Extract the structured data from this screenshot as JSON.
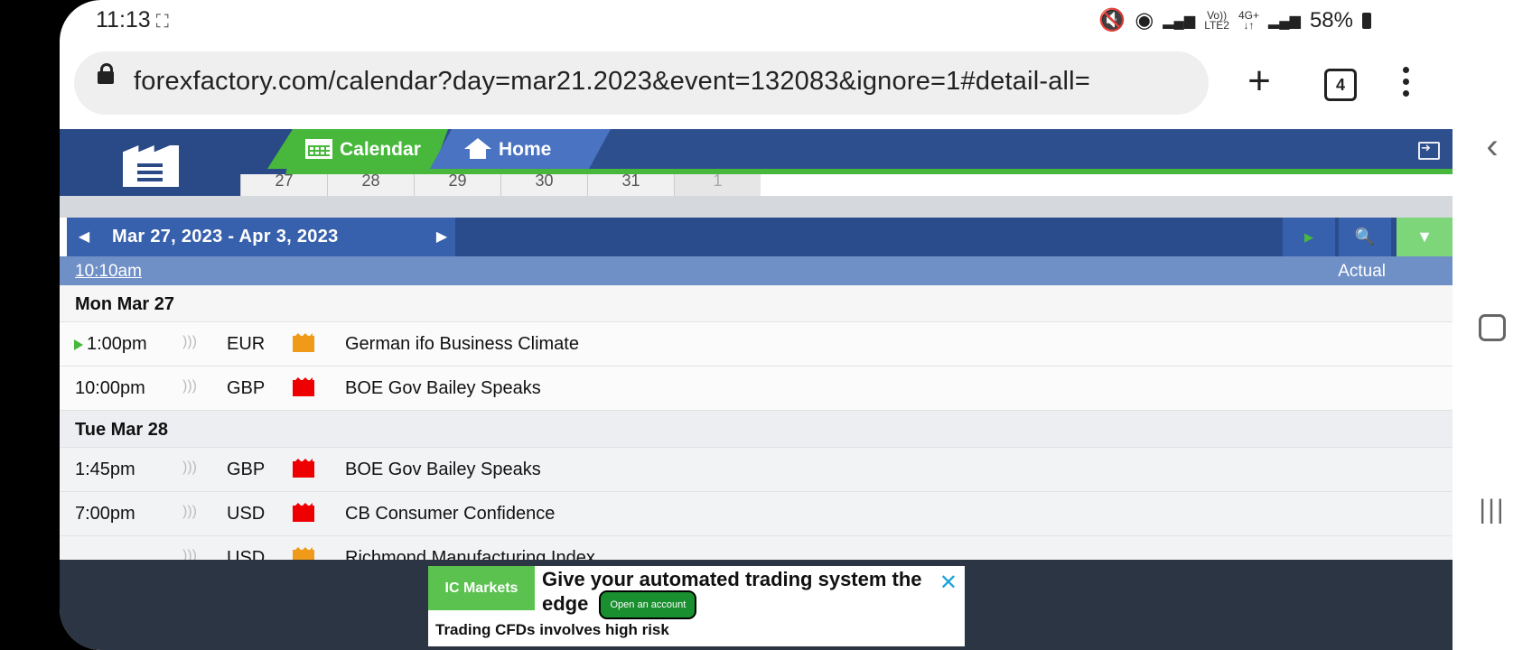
{
  "status_bar": {
    "time": "11:13",
    "screenshot_indicator": "⛶",
    "network_mini_1": "Vo))\nLTE2",
    "network_mini_2": "4G+\n↓↑",
    "battery": "58%"
  },
  "browser": {
    "url": "forexfactory.com/calendar?day=mar21.2023&event=132083&ignore=1#detail-all=",
    "new_tab_label": "+",
    "tab_count": "4"
  },
  "site": {
    "nav_tabs": [
      {
        "label": "Calendar",
        "icon": "calendar-icon"
      },
      {
        "label": "Home",
        "icon": "home-icon"
      }
    ],
    "day_strip": [
      "27",
      "28",
      "29",
      "30",
      "31",
      "1"
    ],
    "date_range": "Mar 27, 2023 - Apr 3, 2023",
    "current_time": "10:10am",
    "column_actual": "Actual",
    "colors": {
      "header_blue": "#2e4f8e",
      "green": "#47b83c",
      "high_impact": "#e00000",
      "medium_impact": "#f09a1a"
    }
  },
  "events": [
    {
      "day": "Mon Mar 27",
      "items": [
        {
          "time": "1:00pm",
          "currency": "EUR",
          "impact": "medium",
          "name": "German ifo Business Climate",
          "current": true
        },
        {
          "time": "10:00pm",
          "currency": "GBP",
          "impact": "high",
          "name": "BOE Gov Bailey Speaks",
          "current": false
        }
      ]
    },
    {
      "day": "Tue Mar 28",
      "items": [
        {
          "time": "1:45pm",
          "currency": "GBP",
          "impact": "high",
          "name": "BOE Gov Bailey Speaks",
          "current": false
        },
        {
          "time": "7:00pm",
          "currency": "USD",
          "impact": "high",
          "name": "CB Consumer Confidence",
          "current": false
        },
        {
          "time": "",
          "currency": "USD",
          "impact": "medium",
          "name": "Richmond Manufacturing Index",
          "current": false
        }
      ]
    }
  ],
  "ad": {
    "brand": "IC Markets",
    "headline": "Give your automated trading system the edge",
    "cta": "Open an account",
    "disclaimer": "Trading CFDs involves high risk",
    "close": "✕"
  }
}
